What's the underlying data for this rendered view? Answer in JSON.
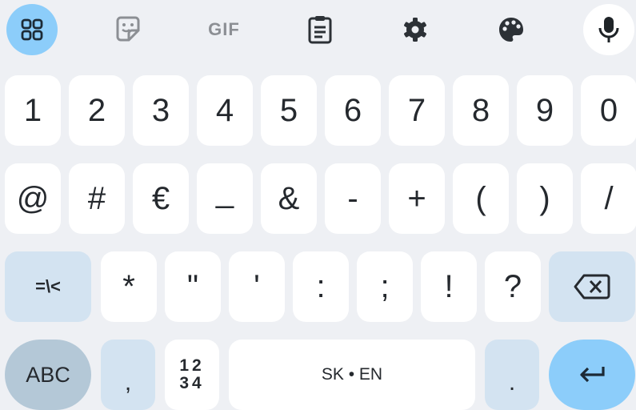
{
  "toolbar": {
    "items": [
      "apps-icon",
      "sticker-icon",
      "gif",
      "clipboard-icon",
      "gear-icon",
      "palette-icon",
      "mic-icon"
    ],
    "gif_label": "GIF"
  },
  "row1": [
    "1",
    "2",
    "3",
    "4",
    "5",
    "6",
    "7",
    "8",
    "9",
    "0"
  ],
  "row2": [
    "@",
    "#",
    "€",
    "_",
    "&",
    "-",
    "+",
    "(",
    ")",
    "/"
  ],
  "row3": {
    "more_symbols": "=\\<",
    "keys": [
      "*",
      "\"",
      "'",
      ":",
      ";",
      "!",
      "?"
    ],
    "delete_icon": "backspace-icon"
  },
  "row4": {
    "abc": "ABC",
    "comma": ",",
    "num_toggle_top": "12",
    "num_toggle_bottom": "34",
    "space": "SK • EN",
    "period": ".",
    "enter_icon": "enter-icon"
  },
  "colors": {
    "background": "#eef0f4",
    "key": "#ffffff",
    "secondary_key": "#d3e3f1",
    "accent": "#8ccdfa",
    "abc_key": "#b4c8d7"
  }
}
